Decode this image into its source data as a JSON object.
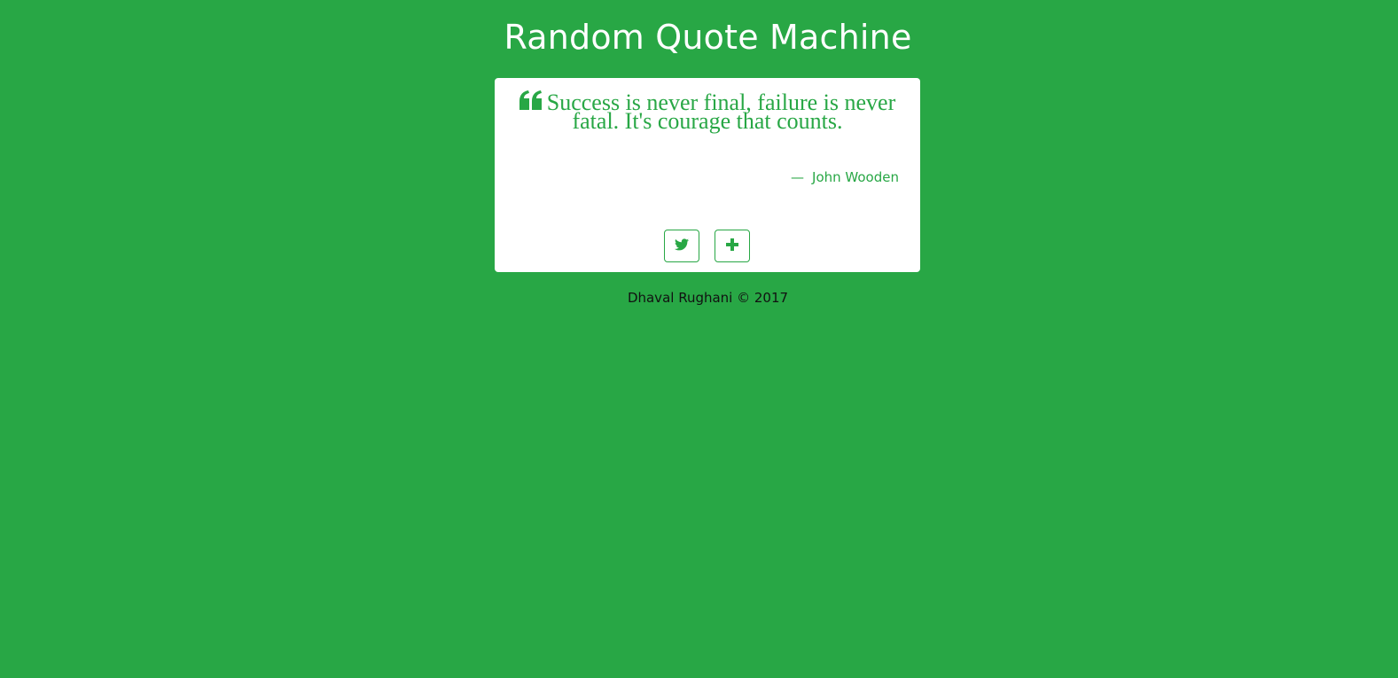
{
  "header": {
    "title": "Random Quote Machine"
  },
  "quote": {
    "text": "Success is never final, failure is never fatal. It's courage that counts.",
    "dash": "—",
    "author": "John Wooden"
  },
  "actions": {
    "tweet_icon": "twitter-icon",
    "new_quote_icon": "plus-icon"
  },
  "footer": {
    "credit": "Dhaval Rughani © 2017"
  },
  "colors": {
    "background": "#28a745",
    "card": "#ffffff",
    "accent": "#28a745",
    "title_text": "#ffffff",
    "footer_text": "#111111"
  }
}
